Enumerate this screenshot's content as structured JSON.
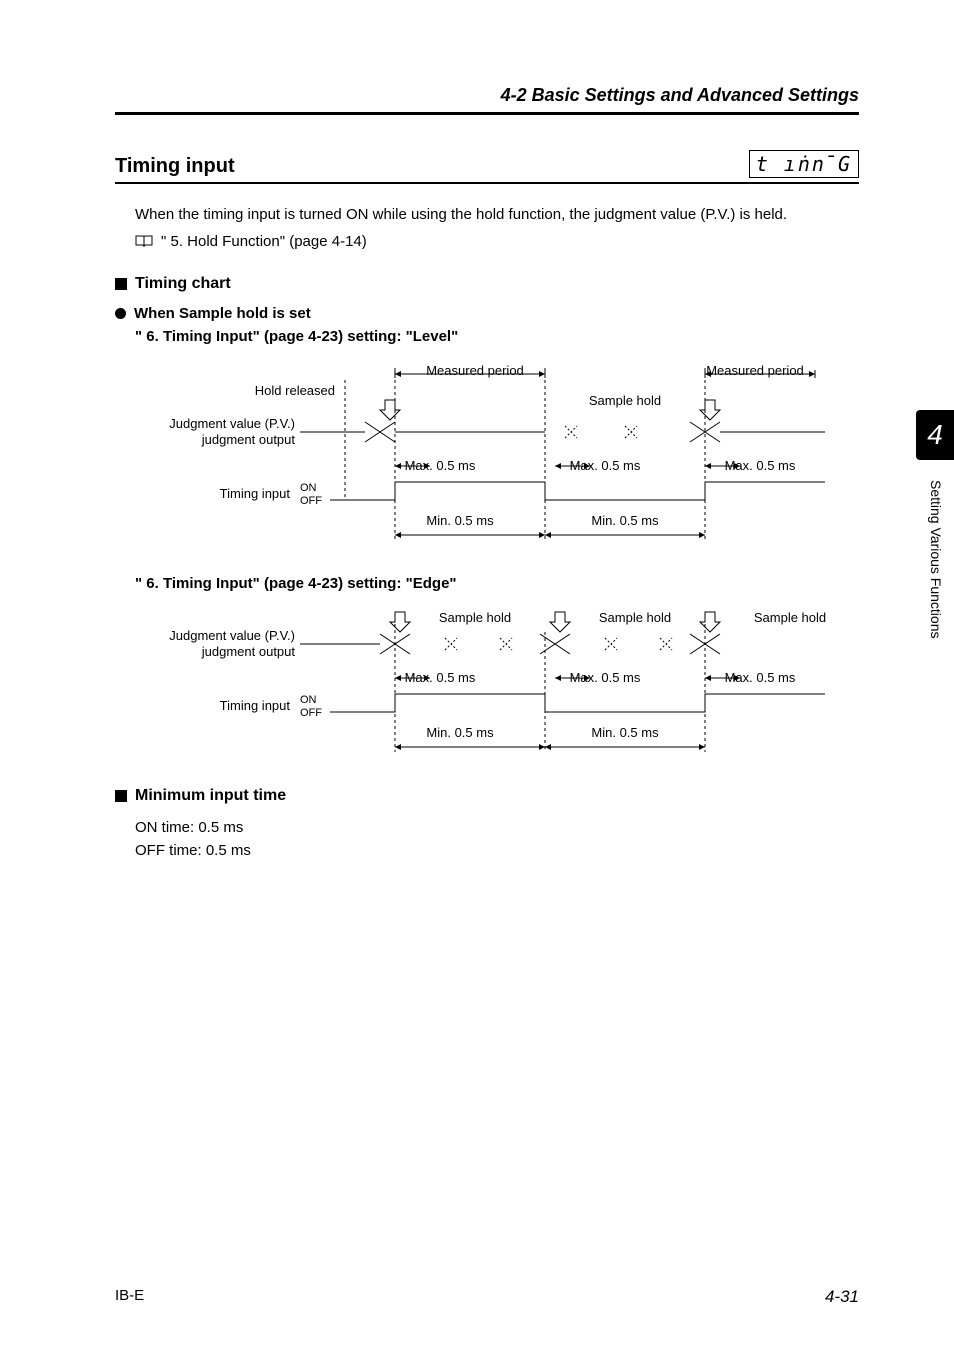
{
  "header": {
    "section_title": "4-2  Basic Settings and Advanced Settings"
  },
  "title": {
    "text": "Timing input",
    "segment_display": "t ıṅn̄G"
  },
  "intro": {
    "text": "When the timing input is turned ON while using the hold function, the judgment value (P.V.) is held.",
    "ref": "\" 5. Hold Function\" (page 4-14)"
  },
  "timing_chart": {
    "heading": "Timing chart",
    "sub1": "When Sample hold is set",
    "level_heading": "\" 6. Timing Input\" (page 4-23) setting: \"Level\"",
    "edge_heading": "\" 6. Timing Input\" (page 4-23) setting: \"Edge\""
  },
  "diagram_labels": {
    "measured_period": "Measured period",
    "hold_released": "Hold released",
    "sample_hold": "Sample hold",
    "judgment_value_pv": "Judgment value (P.V.)",
    "judgment_output": "judgment output",
    "max_05ms": "Max. 0.5 ms",
    "min_05ms": "Min. 0.5 ms",
    "timing_input": "Timing input",
    "on": "ON",
    "off": "OFF"
  },
  "min_input_time": {
    "heading": "Minimum input time",
    "on_line": "ON time: 0.5 ms",
    "off_line": "OFF time: 0.5 ms"
  },
  "side": {
    "chapter": "4",
    "label": "Setting Various Functions"
  },
  "footer": {
    "left": "IB-E",
    "right": "4-31"
  }
}
